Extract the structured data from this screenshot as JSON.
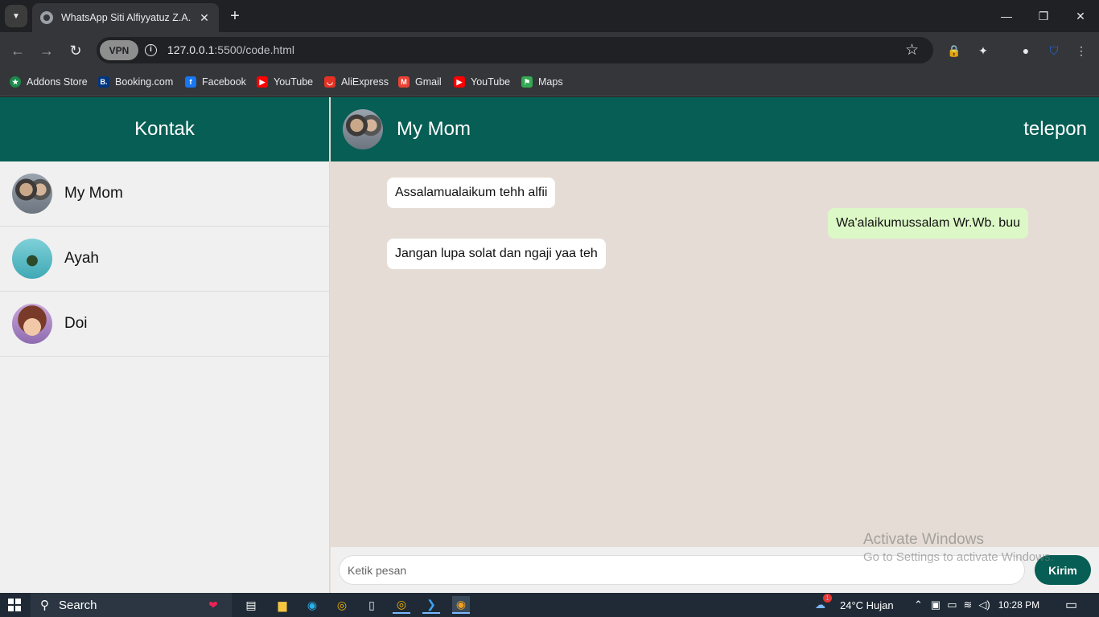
{
  "browser": {
    "tab_title": "WhatsApp Siti Alfiyyatuz Z.A.",
    "url_host": "127.0.0.1",
    "url_path": ":5500/code.html",
    "vpn_label": "VPN",
    "bookmarks": [
      {
        "label": "Addons Store",
        "icon": "addons-store-icon",
        "color": "#1a8a4a"
      },
      {
        "label": "Booking.com",
        "icon": "booking-icon",
        "color": "#003580"
      },
      {
        "label": "Facebook",
        "icon": "facebook-icon",
        "color": "#1877f2"
      },
      {
        "label": "YouTube",
        "icon": "youtube-icon",
        "color": "#ff0000"
      },
      {
        "label": "AliExpress",
        "icon": "aliexpress-icon",
        "color": "#e43225"
      },
      {
        "label": "Gmail",
        "icon": "gmail-icon",
        "color": "#ea4335"
      },
      {
        "label": "YouTube",
        "icon": "youtube-icon",
        "color": "#ff0000"
      },
      {
        "label": "Maps",
        "icon": "maps-icon",
        "color": "#34a853"
      }
    ]
  },
  "sidebar": {
    "title": "Kontak",
    "contacts": [
      {
        "name": "My Mom",
        "avatar": "avatar-photo"
      },
      {
        "name": "Ayah",
        "avatar": "avatar-photo"
      },
      {
        "name": "Doi",
        "avatar": "avatar-photo"
      }
    ]
  },
  "chat": {
    "contact_name": "My Mom",
    "call_label": "telepon",
    "messages": [
      {
        "direction": "in",
        "text": "Assalamualaikum tehh alfii"
      },
      {
        "direction": "out",
        "text": "Wa'alaikumussalam Wr.Wb. buu"
      },
      {
        "direction": "in",
        "text": "Jangan lupa solat dan ngaji yaa teh"
      }
    ],
    "input_placeholder": "Ketik pesan",
    "send_label": "Kirim"
  },
  "watermark": {
    "line1": "Activate Windows",
    "line2": "Go to Settings to activate Windows."
  },
  "taskbar": {
    "search_label": "Search",
    "weather": "24°C  Hujan",
    "time": "10:28 PM",
    "weather_badge": "1"
  },
  "colors": {
    "header_green": "#075e54",
    "chat_bg": "#e5ddd5",
    "outgoing_bubble": "#dcf8c6",
    "incoming_bubble": "#ffffff"
  }
}
